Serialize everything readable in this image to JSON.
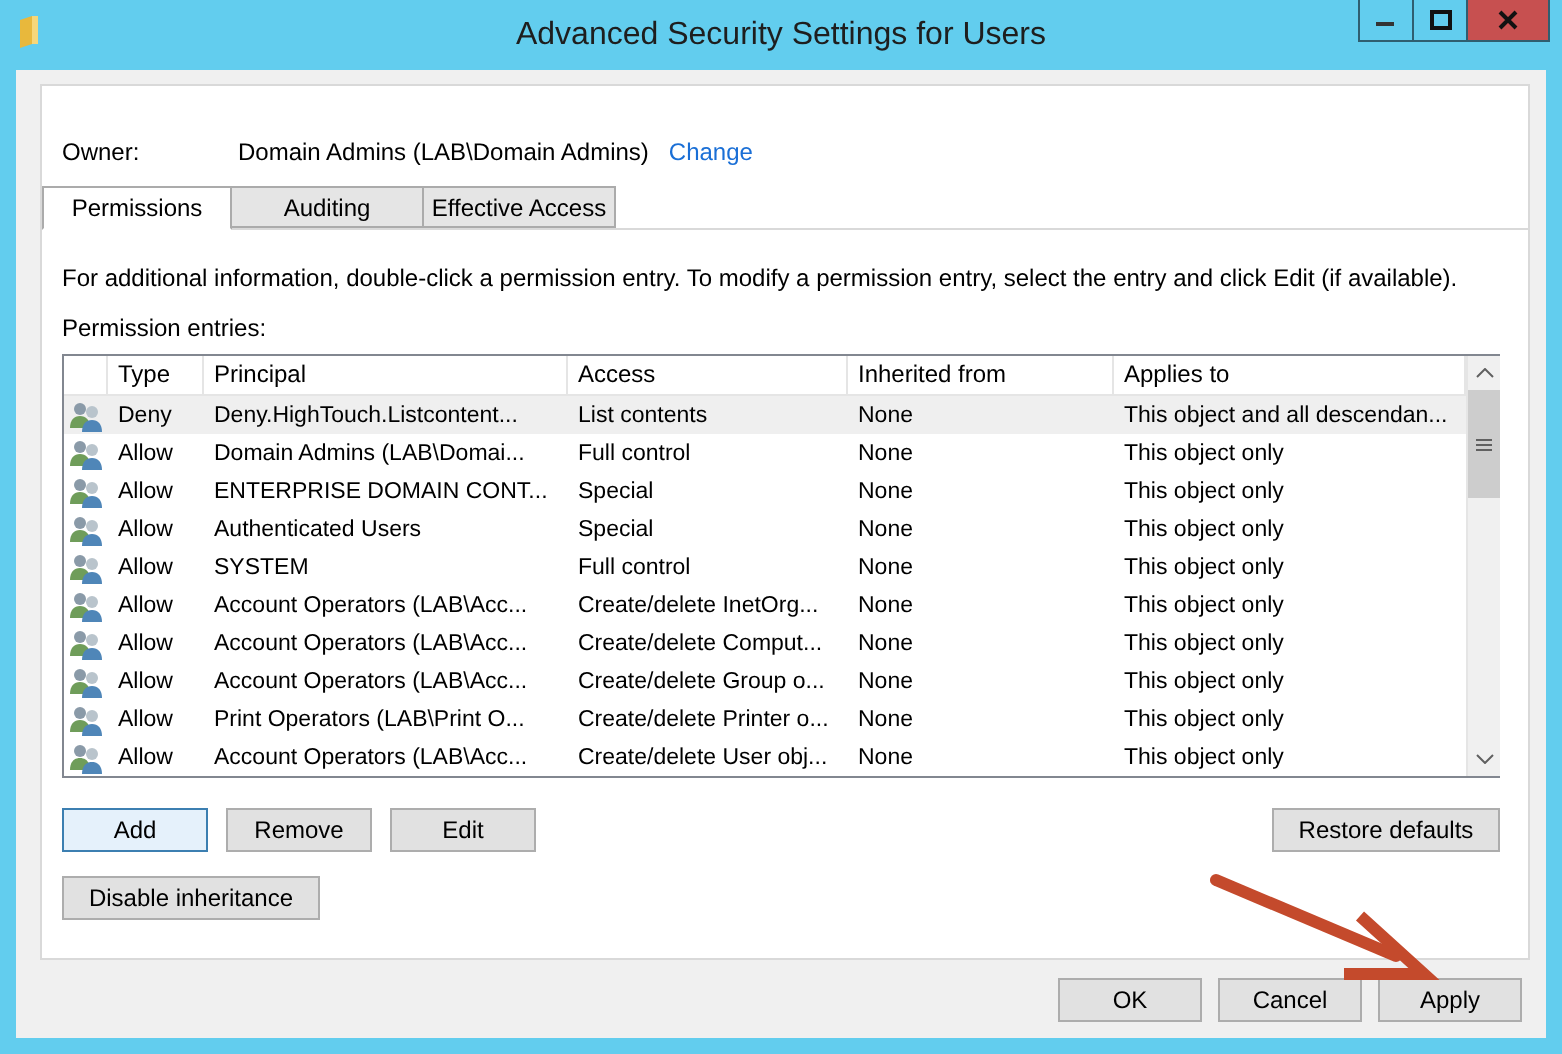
{
  "window": {
    "title": "Advanced Security Settings for Users"
  },
  "owner": {
    "label": "Owner:",
    "value": "Domain Admins (LAB\\Domain Admins)",
    "link": "Change"
  },
  "tabs": [
    {
      "label": "Permissions",
      "selected": true
    },
    {
      "label": "Auditing",
      "selected": false
    },
    {
      "label": "Effective Access",
      "selected": false
    }
  ],
  "description": "For additional information, double-click a permission entry. To modify a permission entry, select the entry and click Edit (if available).",
  "entries_label": "Permission entries:",
  "table": {
    "columns": [
      "Type",
      "Principal",
      "Access",
      "Inherited from",
      "Applies to"
    ],
    "rows": [
      {
        "cells": [
          "Deny",
          "Deny.HighTouch.Listcontent...",
          "List contents",
          "None",
          "This object and all descendan..."
        ],
        "selected": true
      },
      {
        "cells": [
          "Allow",
          "Domain Admins (LAB\\Domai...",
          "Full control",
          "None",
          "This object only"
        ],
        "selected": false
      },
      {
        "cells": [
          "Allow",
          "ENTERPRISE DOMAIN CONT...",
          "Special",
          "None",
          "This object only"
        ],
        "selected": false
      },
      {
        "cells": [
          "Allow",
          "Authenticated Users",
          "Special",
          "None",
          "This object only"
        ],
        "selected": false
      },
      {
        "cells": [
          "Allow",
          "SYSTEM",
          "Full control",
          "None",
          "This object only"
        ],
        "selected": false
      },
      {
        "cells": [
          "Allow",
          "Account Operators (LAB\\Acc...",
          "Create/delete InetOrg...",
          "None",
          "This object only"
        ],
        "selected": false
      },
      {
        "cells": [
          "Allow",
          "Account Operators (LAB\\Acc...",
          "Create/delete Comput...",
          "None",
          "This object only"
        ],
        "selected": false
      },
      {
        "cells": [
          "Allow",
          "Account Operators (LAB\\Acc...",
          "Create/delete Group o...",
          "None",
          "This object only"
        ],
        "selected": false
      },
      {
        "cells": [
          "Allow",
          "Print Operators (LAB\\Print O...",
          "Create/delete Printer o...",
          "None",
          "This object only"
        ],
        "selected": false
      },
      {
        "cells": [
          "Allow",
          "Account Operators (LAB\\Acc...",
          "Create/delete User obj...",
          "None",
          "This object only"
        ],
        "selected": false
      }
    ]
  },
  "entry_buttons": [
    {
      "label": "Add",
      "focused": true
    },
    {
      "label": "Remove",
      "focused": false
    },
    {
      "label": "Edit",
      "focused": false
    }
  ],
  "restore_button": "Restore defaults",
  "inheritance_button": "Disable inheritance",
  "dialog_buttons": [
    "OK",
    "Cancel",
    "Apply"
  ]
}
